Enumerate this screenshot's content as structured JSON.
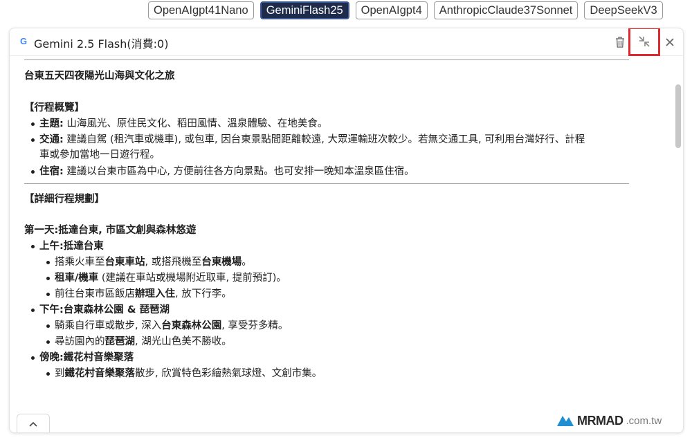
{
  "model_tabs": [
    {
      "label": "OpenAIgpt41Nano",
      "active": false
    },
    {
      "label": "GeminiFlash25",
      "active": true
    },
    {
      "label": "OpenAIgpt4",
      "active": false
    },
    {
      "label": "AnthropicClaude37Sonnet",
      "active": false
    },
    {
      "label": "DeepSeekV3",
      "active": false
    }
  ],
  "panel": {
    "logo_letter": "G",
    "title": "Gemini 2.5 Flash(消費:0)",
    "icons": {
      "trash": "trash-icon",
      "collapse": "collapse-icon",
      "close": "close-icon"
    }
  },
  "content": {
    "title": "台東五天四夜陽光山海與文化之旅",
    "overview_heading": "【行程概覽】",
    "overview": [
      {
        "label": "主題:",
        "text": "山海風光、原住民文化、稻田風情、溫泉體驗、在地美食。"
      },
      {
        "label": "交通:",
        "text": "建議自駕 (租汽車或機車), 或包車, 因台東景點間距離較遠, 大眾運輸班次較少。若無交通工具, 可利用台灣好行、計程",
        "cont": "車或參加當地一日遊行程。"
      },
      {
        "label": "住宿:",
        "text": "建議以台東市區為中心, 方便前往各方向景點。也可安排一晚知本溫泉區住宿。"
      }
    ],
    "detail_heading": "【詳細行程規劃】",
    "day1_title": "第一天:抵達台東, 市區文創與森林悠遊",
    "morning": {
      "label": "上午:抵達台東",
      "items": [
        {
          "pre": "搭乘火車至",
          "b1": "台東車站",
          "mid": ", 或搭飛機至",
          "b2": "台東機場",
          "post": "。"
        },
        {
          "b1": "租車/機車",
          "post": " (建議在車站或機場附近取車, 提前預訂)。"
        },
        {
          "pre": "前往台東市區飯店",
          "b1": "辦理入住",
          "post": ", 放下行李。"
        }
      ]
    },
    "afternoon": {
      "label": "下午:台東森林公園 & 琵琶湖",
      "items": [
        {
          "pre": "騎乘自行車或散步, 深入",
          "b1": "台東森林公園",
          "post": ", 享受芬多精。"
        },
        {
          "pre": "尋訪園內的",
          "b1": "琵琶湖",
          "post": ", 湖光山色美不勝收。"
        }
      ]
    },
    "evening": {
      "label": "傍晚:鐵花村音樂聚落",
      "items": [
        {
          "pre": "到",
          "b1": "鐵花村音樂聚落",
          "post": "散步, 欣賞特色彩繪熱氣球燈、文創市集。"
        }
      ]
    }
  },
  "footer": {
    "up_icon": "chevron-up-icon"
  },
  "watermark": {
    "text": "MRMAD",
    "sub": ".com.tw"
  },
  "colors": {
    "active_tab": "#1e2b4a",
    "highlight": "#e0292f"
  }
}
